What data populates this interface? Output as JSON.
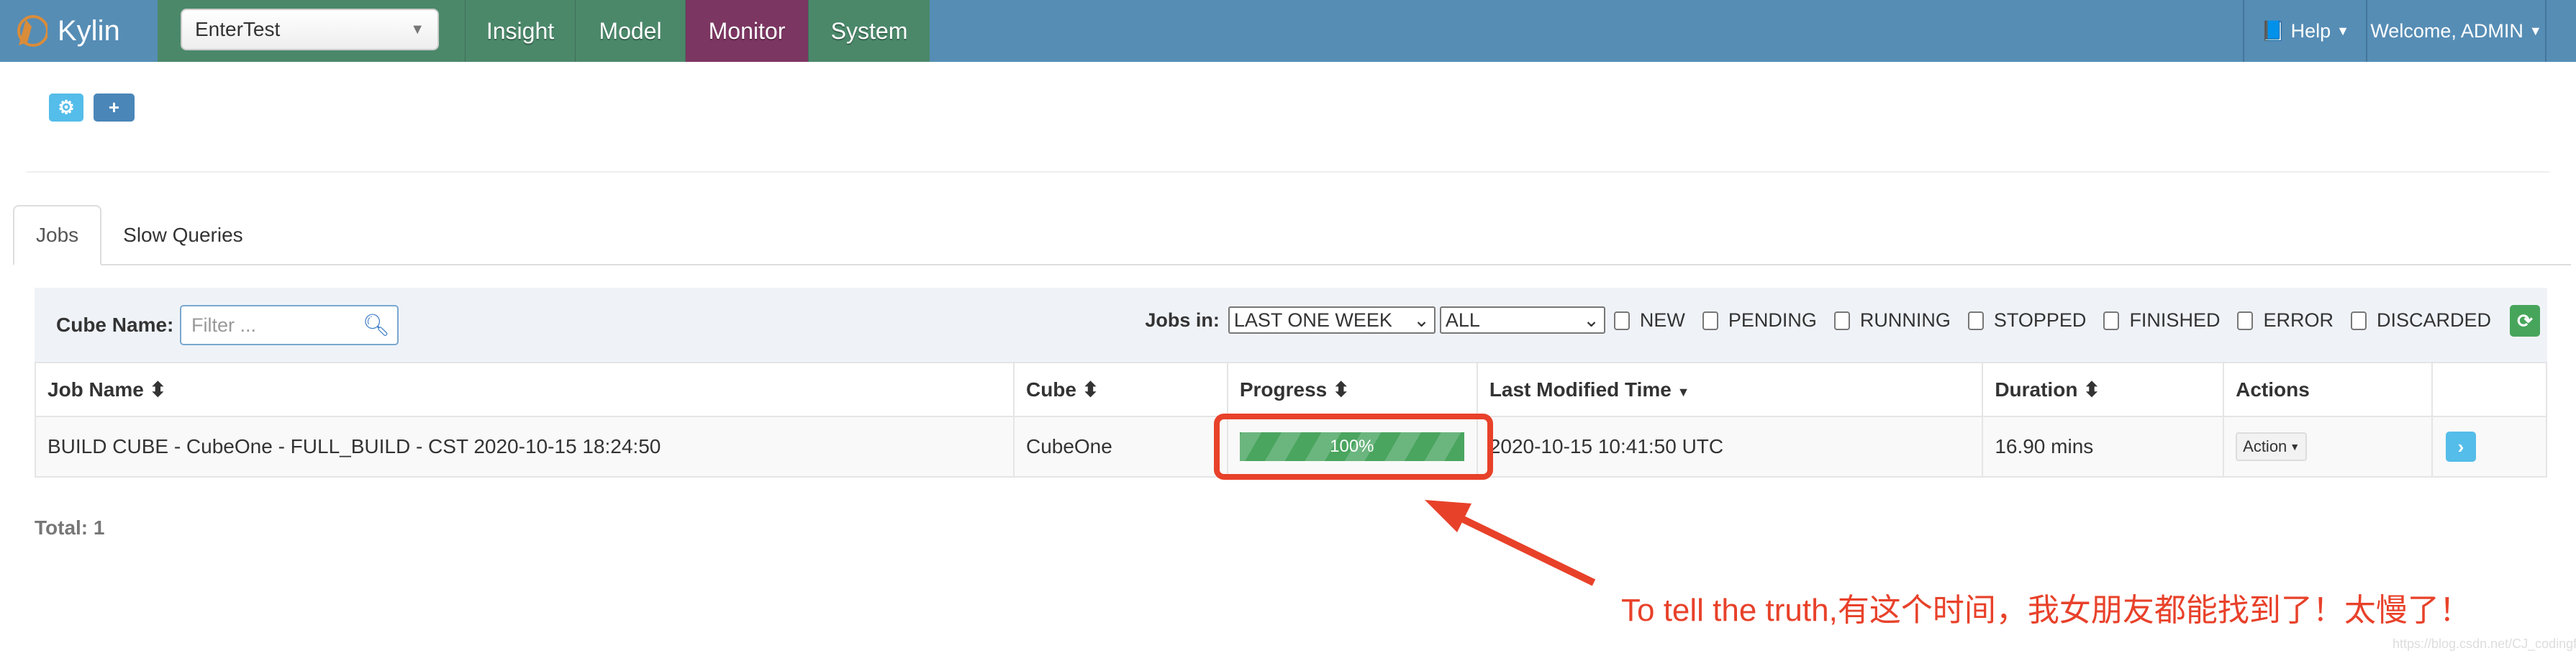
{
  "header": {
    "brand": "Kylin",
    "project": "EnterTest",
    "nav": [
      {
        "label": "Insight",
        "color": "#4b886a"
      },
      {
        "label": "Model",
        "color": "#4b886a"
      },
      {
        "label": "Monitor",
        "color": "#7c3662"
      },
      {
        "label": "System",
        "color": "#4b886a"
      }
    ],
    "help": "Help",
    "welcome": "Welcome, ADMIN"
  },
  "tabs": [
    {
      "label": "Jobs",
      "active": true
    },
    {
      "label": "Slow Queries",
      "active": false
    }
  ],
  "filter": {
    "cube_label": "Cube Name:",
    "cube_placeholder": "Filter ...",
    "jobs_in_label": "Jobs in:",
    "time_range": "LAST ONE WEEK",
    "job_type": "ALL",
    "statuses": [
      "NEW",
      "PENDING",
      "RUNNING",
      "STOPPED",
      "FINISHED",
      "ERROR",
      "DISCARDED"
    ]
  },
  "table": {
    "headers": [
      "Job Name",
      "Cube",
      "Progress",
      "Last Modified Time",
      "Duration",
      "Actions"
    ],
    "rows": [
      {
        "job_name": "BUILD CUBE - CubeOne - FULL_BUILD - CST 2020-10-15 18:24:50",
        "cube": "CubeOne",
        "progress": "100%",
        "progress_value": 100,
        "last_modified": "2020-10-15 10:41:50 UTC",
        "duration": "16.90 mins",
        "action": "Action"
      }
    ]
  },
  "total": "Total: 1",
  "annotation": {
    "text": "To tell the truth,有这个时间，我女朋友都能找到了！太慢了！",
    "color": "#e8412a"
  },
  "watermark": "https://blog.csdn.net/CJ_codingfish"
}
